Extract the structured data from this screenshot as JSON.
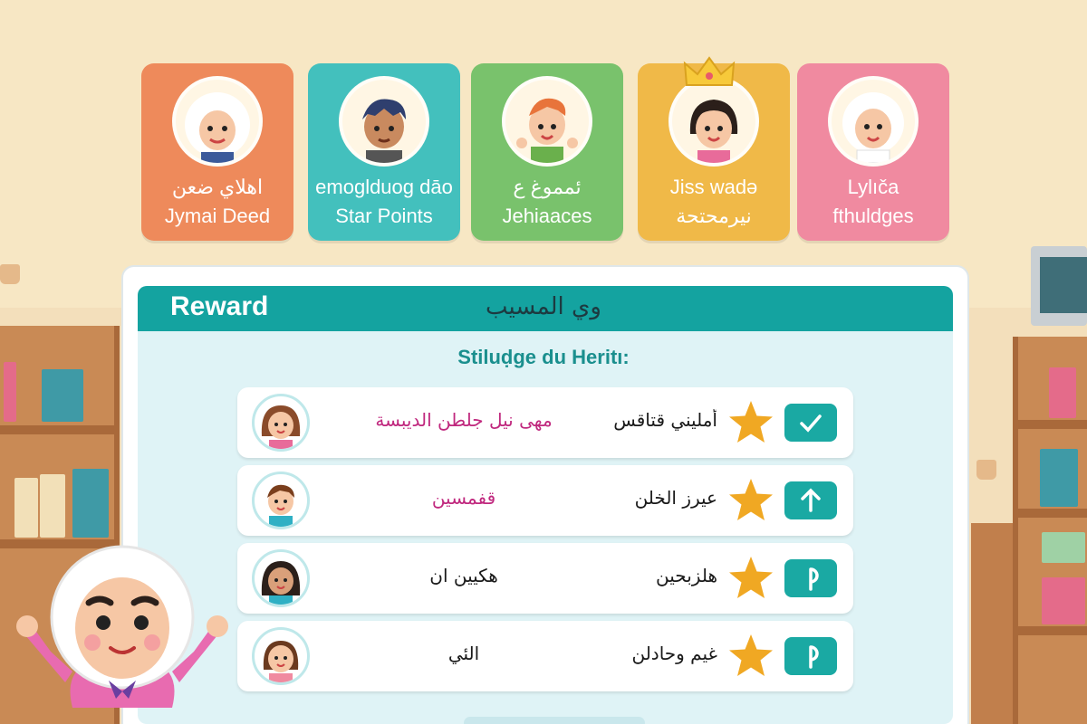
{
  "cards": [
    {
      "line1": "اهلاي ضعن",
      "line2": "Jymai Deed",
      "color": "#ee8a5b"
    },
    {
      "line1": "emoglduog dāo",
      "line2": "Star Points",
      "color": "#43c0bd"
    },
    {
      "line1": "ئمموغ ع",
      "line2": "Jehiaaces",
      "color": "#79c26c"
    },
    {
      "line1": "Jiss wadə",
      "line2": "نيرمحتحة",
      "color": "#f0b948"
    },
    {
      "line1": "Lylıča",
      "line2": "fthuldges",
      "color": "#f08aa0"
    }
  ],
  "panel": {
    "title": "Reward",
    "arabic_title": "وي المسيب",
    "subtitle": "Stiluḍge du Heritı:"
  },
  "rows": [
    {
      "name": "مهى نيل جلطن الديبسة",
      "name_color": "#c0287e",
      "points": "أمليني قتاقس",
      "action_icon": "check-icon"
    },
    {
      "name": "قفمسين",
      "name_color": "#c0287e",
      "points": "عيرز الخلن",
      "action_icon": "arrow-up-icon"
    },
    {
      "name": "هكيين ان",
      "name_color": "#1a1a1a",
      "points": "هلزبحين",
      "action_icon": "p-icon"
    },
    {
      "name": "الئي",
      "name_color": "#1a1a1a",
      "points": "غيم وحادلن",
      "action_icon": "p-icon"
    }
  ],
  "colors": {
    "accent": "#14a3a0",
    "star": "#f0a823",
    "background": "#f7e7c4"
  }
}
